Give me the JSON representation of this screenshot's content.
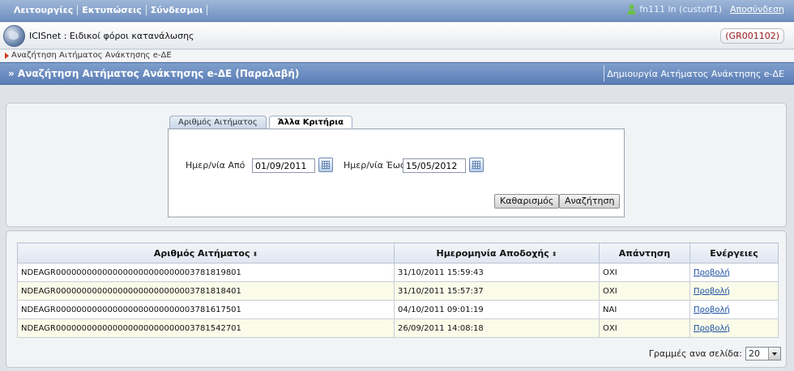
{
  "menu": {
    "items": [
      "Λειτουργίες",
      "Εκτυπώσεις",
      "Σύνδεσμοι"
    ],
    "user": "fn111 ln (custoff1)",
    "logout": "Αποσύνδεση"
  },
  "app": {
    "title": "ICISnet : Ειδικοί φόροι κατανάλωσης",
    "code": "(GR001102)"
  },
  "breadcrumb": "Αναζήτηση Αιτήματος Ανάκτησης e-ΔΕ",
  "page": {
    "title": "» Αναζήτηση Αιτήματος Ανάκτησης e-ΔΕ (Παραλαβή)",
    "create_link": "Δημιουργία Αιτήματος Ανάκτησης e-ΔΕ"
  },
  "search": {
    "tabs": [
      "Αριθμός Αιτήματος",
      "Άλλα Κριτήρια"
    ],
    "active_tab": 1,
    "date_from_label": "Ημερ/νία Από",
    "date_from_value": "01/09/2011",
    "date_to_label": "Ημερ/νία Έως",
    "date_to_value": "15/05/2012",
    "clear_button": "Καθαρισμός",
    "search_button": "Αναζήτηση"
  },
  "results": {
    "columns": [
      "Αριθμός Αιτήματος",
      "Ημερομηνία Αποδοχής",
      "Απάντηση",
      "Ενέργειες"
    ],
    "sort_icon": "⬍",
    "rows": [
      {
        "id": "NDEAGR000000000000000000000000003781819801",
        "date": "31/10/2011 15:59:43",
        "answer": "ΟΧΙ",
        "action": "Προβολή"
      },
      {
        "id": "NDEAGR000000000000000000000000003781818401",
        "date": "31/10/2011 15:57:37",
        "answer": "ΟΧΙ",
        "action": "Προβολή"
      },
      {
        "id": "NDEAGR000000000000000000000000003781617501",
        "date": "04/10/2011 09:01:19",
        "answer": "ΝΑΙ",
        "action": "Προβολή"
      },
      {
        "id": "NDEAGR000000000000000000000000003781542701",
        "date": "26/09/2011 14:08:18",
        "answer": "ΟΧΙ",
        "action": "Προβολή"
      }
    ],
    "rows_per_page_label": "Γραμμές ανα σελίδα:",
    "rows_per_page_value": "20"
  }
}
